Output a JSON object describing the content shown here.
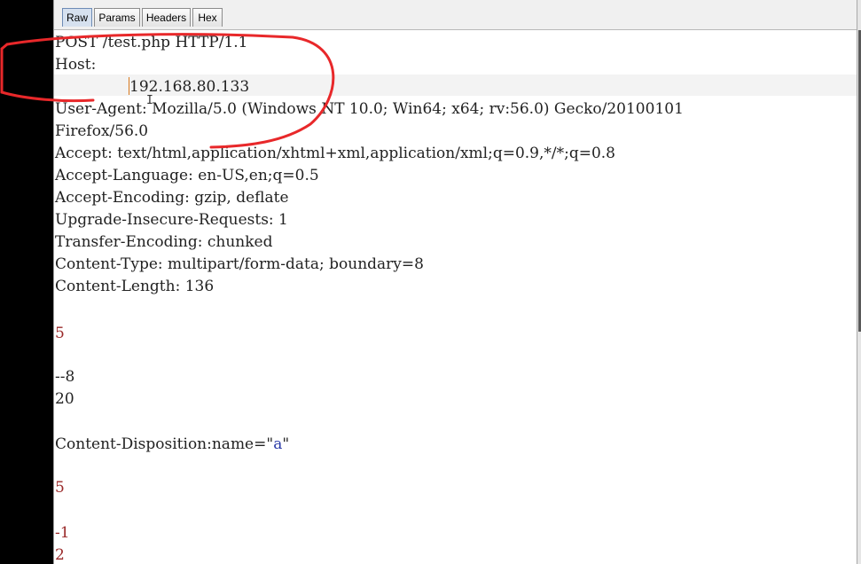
{
  "tabs": [
    {
      "label": "Raw"
    },
    {
      "label": "Params"
    },
    {
      "label": "Headers"
    },
    {
      "label": "Hex"
    }
  ],
  "request": {
    "request_line": "POST /test.php HTTP/1.1",
    "host_key": "Host:",
    "host_value": "192.168.80.133",
    "user_agent": "User-Agent: Mozilla/5.0 (Windows NT 10.0; Win64; x64; rv:56.0) Gecko/20100101",
    "user_agent_cont": "Firefox/56.0",
    "accept": "Accept: text/html,application/xhtml+xml,application/xml;q=0.9,*/*;q=0.8",
    "accept_language": "Accept-Language: en-US,en;q=0.5",
    "accept_encoding": "Accept-Encoding: gzip, deflate",
    "upgrade": "Upgrade-Insecure-Requests: 1",
    "transfer_encoding": "Transfer-Encoding: chunked",
    "content_type": "Content-Type: multipart/form-data; boundary=8",
    "content_length": "Content-Length: 136"
  },
  "body": {
    "chunk1_size": "5",
    "boundary": "--8",
    "chunk2_size": "20",
    "disposition_prefix": "Content-Disposition:name=\"",
    "disposition_value": "a",
    "disposition_suffix": "\"",
    "chunk3_size": "5",
    "chunk3_data": "-1",
    "chunk4_size": "2"
  },
  "colors": {
    "annotation_red": "#e8282a",
    "caret": "#d87a1f"
  }
}
